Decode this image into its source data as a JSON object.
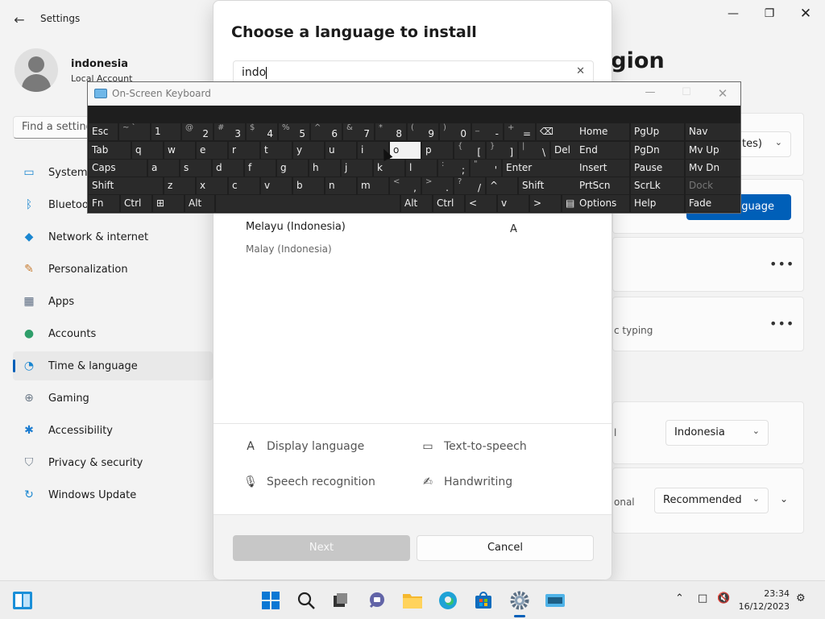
{
  "settings": {
    "title": "Settings",
    "user": {
      "name": "indonesia",
      "account": "Local Account"
    },
    "search_placeholder": "Find a setting",
    "nav": [
      {
        "label": "System",
        "icon": "system-icon"
      },
      {
        "label": "Bluetooth & devices",
        "icon": "bluetooth-icon"
      },
      {
        "label": "Network & internet",
        "icon": "wifi-icon"
      },
      {
        "label": "Personalization",
        "icon": "brush-icon"
      },
      {
        "label": "Apps",
        "icon": "apps-icon"
      },
      {
        "label": "Accounts",
        "icon": "accounts-icon"
      },
      {
        "label": "Time & language",
        "icon": "clock-globe-icon"
      },
      {
        "label": "Gaming",
        "icon": "gamepad-icon"
      },
      {
        "label": "Accessibility",
        "icon": "accessibility-icon"
      },
      {
        "label": "Privacy & security",
        "icon": "shield-icon"
      },
      {
        "label": "Windows Update",
        "icon": "update-icon"
      }
    ],
    "active_nav": "Time & language",
    "page_title_partial": "egion",
    "timezone_dropdown_partial": "tes)",
    "add_language_partial": "nguage",
    "typing_partial": "c typing",
    "country_dropdown": "Indonesia",
    "regional_partial": "onal",
    "format_dropdown": "Recommended"
  },
  "dialog": {
    "title": "Choose a language to install",
    "search_value": "indo",
    "result": {
      "native": "Melayu (Indonesia)",
      "english": "Malay (Indonesia)"
    },
    "features": [
      {
        "label": "Display language",
        "icon": "display-language-icon"
      },
      {
        "label": "Text-to-speech",
        "icon": "text-to-speech-icon"
      },
      {
        "label": "Speech recognition",
        "icon": "microphone-icon"
      },
      {
        "label": "Handwriting",
        "icon": "handwriting-icon"
      }
    ],
    "next_label": "Next",
    "cancel_label": "Cancel"
  },
  "osk": {
    "title": "On-Screen Keyboard",
    "rows": [
      [
        {
          "m": "Esc"
        },
        {
          "s": "~ `"
        },
        {
          "m": "1"
        },
        {
          "s": "@",
          "m": "2"
        },
        {
          "s": "#",
          "m": "3"
        },
        {
          "s": "$",
          "m": "4"
        },
        {
          "s": "%",
          "m": "5"
        },
        {
          "s": "^",
          "m": "6"
        },
        {
          "s": "&",
          "m": "7"
        },
        {
          "s": "*",
          "m": "8"
        },
        {
          "s": "(",
          "m": "9"
        },
        {
          "s": ")",
          "m": "0"
        },
        {
          "s": "_",
          "m": "-"
        },
        {
          "s": "+",
          "m": "="
        },
        {
          "m": "⌫"
        }
      ],
      [
        {
          "m": "Tab"
        },
        {
          "m": "q"
        },
        {
          "m": "w"
        },
        {
          "m": "e"
        },
        {
          "m": "r"
        },
        {
          "m": "t"
        },
        {
          "m": "y"
        },
        {
          "m": "u"
        },
        {
          "m": "i"
        },
        {
          "m": "o"
        },
        {
          "m": "p"
        },
        {
          "s": "{",
          "m": "["
        },
        {
          "s": "}",
          "m": "]"
        },
        {
          "s": "|",
          "m": "\\"
        },
        {
          "m": "Del"
        }
      ],
      [
        {
          "m": "Caps"
        },
        {
          "m": "a"
        },
        {
          "m": "s"
        },
        {
          "m": "d"
        },
        {
          "m": "f"
        },
        {
          "m": "g"
        },
        {
          "m": "h"
        },
        {
          "m": "j"
        },
        {
          "m": "k"
        },
        {
          "m": "l"
        },
        {
          "s": ":",
          "m": ";"
        },
        {
          "s": "\"",
          "m": "'"
        },
        {
          "m": "Enter"
        }
      ],
      [
        {
          "m": "Shift"
        },
        {
          "m": "z"
        },
        {
          "m": "x"
        },
        {
          "m": "c"
        },
        {
          "m": "v"
        },
        {
          "m": "b"
        },
        {
          "m": "n"
        },
        {
          "m": "m"
        },
        {
          "s": "<",
          "m": ","
        },
        {
          "s": ">",
          "m": "."
        },
        {
          "s": "?",
          "m": "/"
        },
        {
          "m": "^"
        },
        {
          "m": "Shift"
        }
      ],
      [
        {
          "m": "Fn"
        },
        {
          "m": "Ctrl"
        },
        {
          "m": "⊞"
        },
        {
          "m": "Alt"
        },
        {
          "m": ""
        },
        {
          "m": "Alt"
        },
        {
          "m": "Ctrl"
        },
        {
          "m": "<"
        },
        {
          "m": "v"
        },
        {
          "m": ">"
        },
        {
          "m": "▤"
        }
      ]
    ],
    "nav_cols": [
      [
        "Home",
        "PgUp",
        "Nav"
      ],
      [
        "End",
        "PgDn",
        "Mv Up"
      ],
      [
        "Insert",
        "Pause",
        "Mv Dn"
      ],
      [
        "PrtScn",
        "ScrLk",
        "Dock"
      ],
      [
        "Options",
        "Help",
        "Fade"
      ]
    ]
  },
  "taskbar": {
    "time": "23:34",
    "date": "16/12/2023",
    "apps": [
      "widgets-icon",
      "start-icon",
      "search-icon",
      "task-view-icon",
      "teams-chat-icon",
      "file-explorer-icon",
      "edge-icon",
      "store-icon",
      "settings-icon",
      "osk-icon"
    ]
  },
  "colors": {
    "accent": "#005fb8",
    "osk_bg": "#1e1e1e",
    "osk_key": "#2a2a2a"
  }
}
